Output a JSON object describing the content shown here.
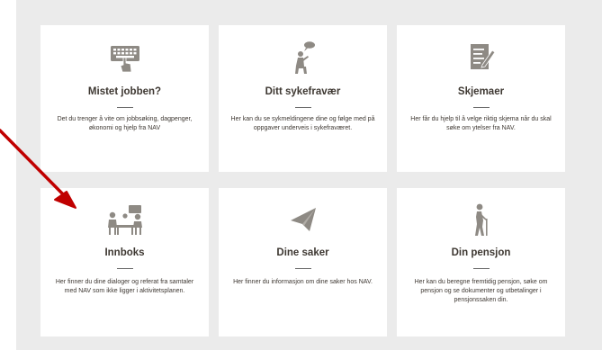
{
  "colors": {
    "panel_bg": "#ebebeb",
    "card_bg": "#ffffff",
    "icon": "#8e8a84",
    "text": "#3e3832",
    "arrow": "#c00000"
  },
  "cards": [
    {
      "title": "Mistet jobben?",
      "icon": "keyboard-hand-icon",
      "description": "Det du trenger å vite om jobbsøking, dagpenger, økonomi og hjelp fra NAV"
    },
    {
      "title": "Ditt sykefravær",
      "icon": "person-speech-icon",
      "description": "Her kan du se sykmeldingene dine og følge med på oppgaver underveis i sykefraværet."
    },
    {
      "title": "Skjemaer",
      "icon": "form-pen-icon",
      "description": "Her får du hjelp til å velge riktig skjema når du skal søke om ytelser fra NAV."
    },
    {
      "title": "Innboks",
      "icon": "meeting-people-icon",
      "description": "Her finner du dine dialoger og referat fra samtaler med NAV som ikke ligger i aktivitetsplanen."
    },
    {
      "title": "Dine saker",
      "icon": "paper-plane-icon",
      "description": "Her finner du informasjon om dine saker hos NAV."
    },
    {
      "title": "Din pensjon",
      "icon": "elderly-cane-icon",
      "description": "Her kan du beregne fremtidig pensjon, søke om pensjon og se dokumenter og utbetalinger i pensjonssaken din."
    }
  ]
}
